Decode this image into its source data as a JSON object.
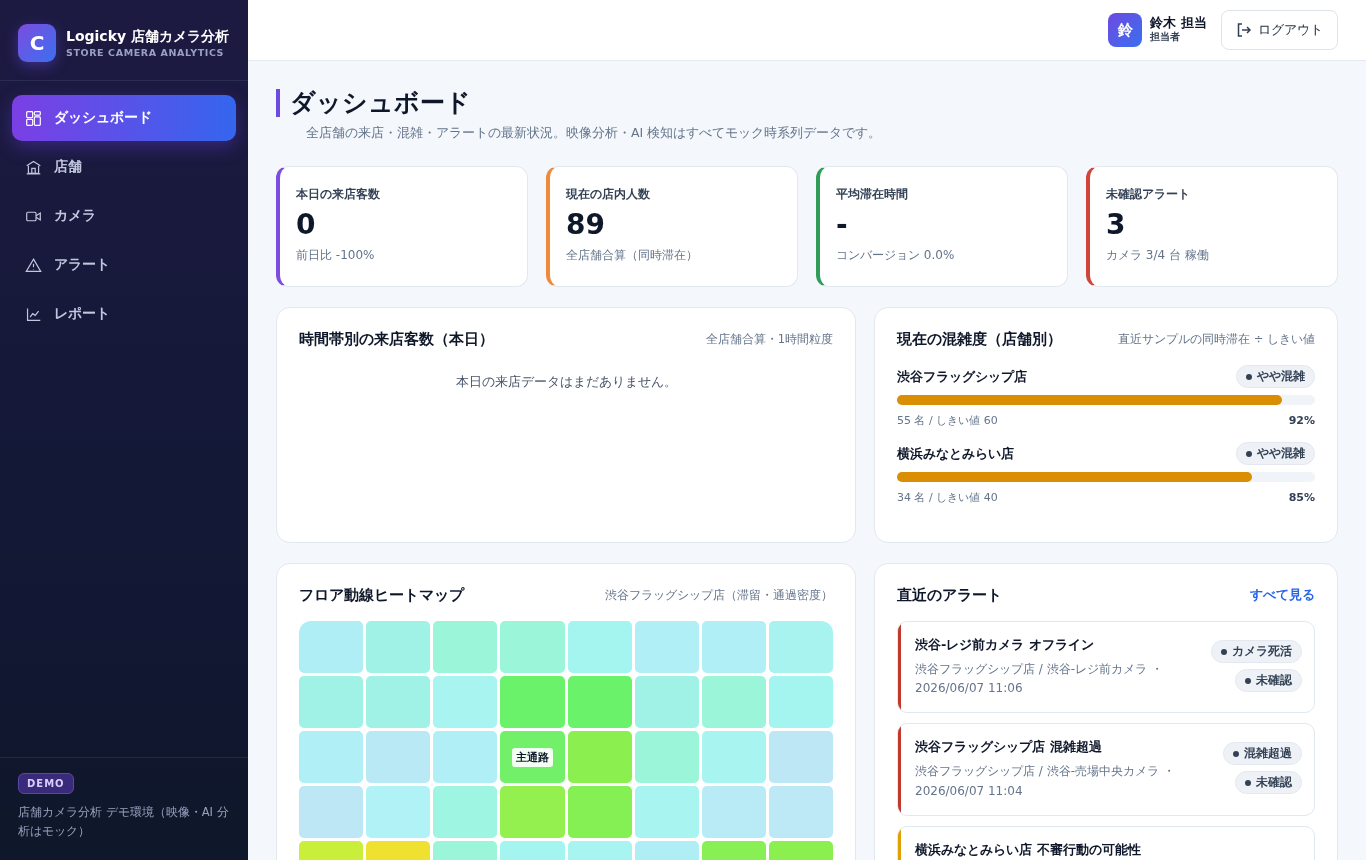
{
  "brand": {
    "logo_letter": "C",
    "title": "Logicky 店舗カメラ分析",
    "subtitle": "STORE CAMERA ANALYTICS"
  },
  "sidebar": {
    "items": [
      {
        "label": "ダッシュボード",
        "selected": true
      },
      {
        "label": "店舗",
        "selected": false
      },
      {
        "label": "カメラ",
        "selected": false
      },
      {
        "label": "アラート",
        "selected": false
      },
      {
        "label": "レポート",
        "selected": false
      }
    ],
    "footer": {
      "badge": "DEMO",
      "note": "店舗カメラ分析 デモ環境（映像・AI 分析はモック）"
    }
  },
  "topbar": {
    "avatar": "鈴",
    "user_name": "鈴木 担当",
    "user_role": "担当者",
    "logout": "ログアウト"
  },
  "page": {
    "title": "ダッシュボード",
    "subtitle": "全店舗の来店・混雑・アラートの最新状況。映像分析・AI 検知はすべてモック時系列データです。"
  },
  "kpis": [
    {
      "label": "本日の来店客数",
      "value": "0",
      "note": "前日比 -100%",
      "color": "#7c4dde"
    },
    {
      "label": "現在の店内人数",
      "value": "89",
      "note": "全店舗合算（同時滞在）",
      "color": "#ee8a3a"
    },
    {
      "label": "平均滞在時間",
      "value": "-",
      "note": "コンバージョン 0.0%",
      "color": "#2f9d57"
    },
    {
      "label": "未確認アラート",
      "value": "3",
      "note": "カメラ 3/4 台 稼働",
      "color": "#d0443a"
    }
  ],
  "hourly": {
    "title": "時間帯別の来店客数（本日）",
    "caption": "全店舗合算・1時間粒度",
    "empty": "本日の来店データはまだありません。"
  },
  "congestion": {
    "title": "現在の混雑度（店舗別）",
    "caption": "直近サンプルの同時滞在 ÷ しきい値",
    "stores": [
      {
        "name": "渋谷フラッグシップ店",
        "status": "やや混雑",
        "level": 0.92,
        "detail": "55 名 / しきい値 60",
        "percent": "92%"
      },
      {
        "name": "横浜みなとみらい店",
        "status": "やや混雑",
        "level": 0.85,
        "detail": "34 名 / しきい値 40",
        "percent": "85%"
      }
    ]
  },
  "heatmap": {
    "title": "フロア動線ヒートマップ",
    "caption": "渋谷フラッグシップ店（滞留・通過密度）",
    "rows": [
      [
        {
          "color": "#b0eef5"
        },
        {
          "color": "#a0f2e6"
        },
        {
          "color": "#9af5d9"
        },
        {
          "color": "#9af5d9"
        },
        {
          "color": "#a4f4ef"
        },
        {
          "color": "#b0eff5"
        },
        {
          "color": "#b0eff5"
        },
        {
          "color": "#a8f3f0"
        }
      ],
      [
        {
          "color": "#a0f2e6"
        },
        {
          "color": "#a0f2e6"
        },
        {
          "color": "#a8f4f0"
        },
        {
          "color": "#6bf26b"
        },
        {
          "color": "#6bf26b"
        },
        {
          "color": "#a0f2e6"
        },
        {
          "color": "#9af5d9"
        },
        {
          "color": "#a4f4ef"
        }
      ],
      [
        {
          "color": "#b0eff5"
        },
        {
          "color": "#b8e9f5"
        },
        {
          "color": "#b0eff5"
        },
        {
          "color": "#72f06a",
          "label": "主通路"
        },
        {
          "color": "#8bf04f"
        },
        {
          "color": "#9af5d9"
        },
        {
          "color": "#a8f4f0"
        },
        {
          "color": "#bde7f5"
        }
      ],
      [
        {
          "color": "#bde7f5"
        },
        {
          "color": "#b0f2f6"
        },
        {
          "color": "#9ef5e2"
        },
        {
          "color": "#94f04e"
        },
        {
          "color": "#84f053"
        },
        {
          "color": "#a8f4f0"
        },
        {
          "color": "#b8ebf5"
        },
        {
          "color": "#bde8f5"
        }
      ],
      [
        {
          "color": "#c9ef3a"
        },
        {
          "color": "#f0e030"
        },
        {
          "color": "#9af5d9"
        },
        {
          "color": "#a4f4ef"
        },
        {
          "color": "#a8f4f0"
        },
        {
          "color": "#b0eef5"
        },
        {
          "color": "#88ef55"
        },
        {
          "color": "#8bf04f"
        }
      ]
    ]
  },
  "alerts": {
    "title": "直近のアラート",
    "link": "すべて見る",
    "items": [
      {
        "title": "渋谷-レジ前カメラ オフライン",
        "meta": "渋谷フラッグシップ店 / 渋谷-レジ前カメラ ・ 2026/06/07 11:06",
        "tags": [
          "カメラ死活",
          "未確認"
        ],
        "color": "#c0392b"
      },
      {
        "title": "渋谷フラッグシップ店 混雑超過",
        "meta": "渋谷フラッグシップ店 / 渋谷-売場中央カメラ ・ 2026/06/07 11:04",
        "tags": [
          "混雑超過",
          "未確認"
        ],
        "color": "#c0392b"
      },
      {
        "title": "横浜みなとみらい店 不審行動の可能性",
        "color": "#e0a100"
      }
    ]
  }
}
